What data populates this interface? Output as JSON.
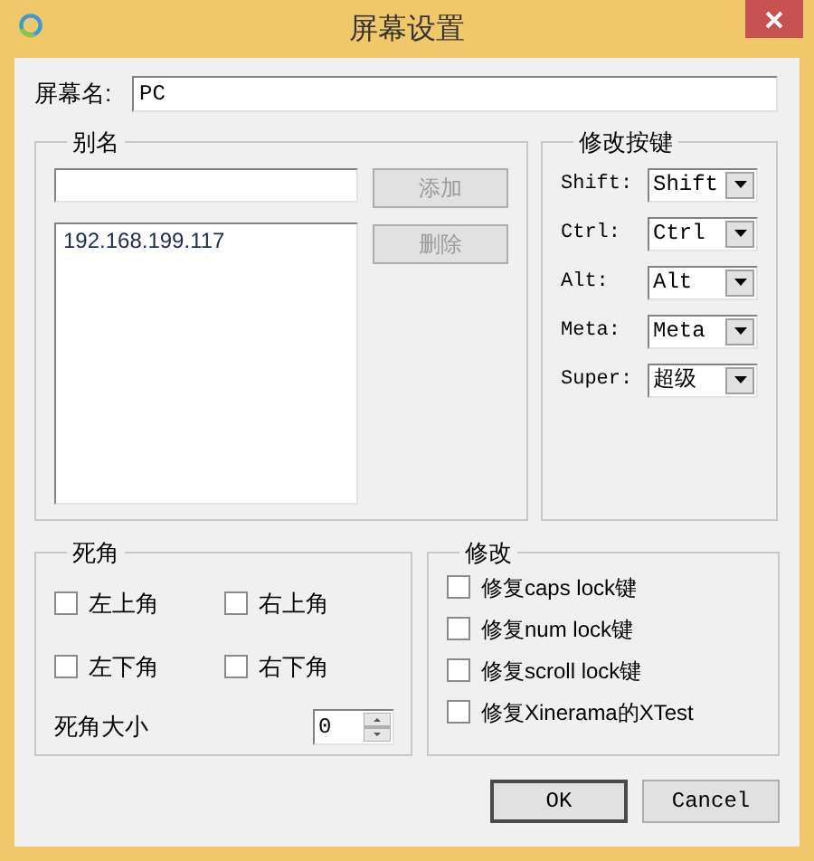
{
  "window": {
    "title": "屏幕设置"
  },
  "screen_name": {
    "label": "屏幕名:",
    "value": "PC"
  },
  "aliases": {
    "title": "别名",
    "add_button": {
      "label": "添加",
      "disabled": true
    },
    "delete_button": {
      "label": "删除",
      "disabled": true
    },
    "items": [
      {
        "text": "192.168.199.117"
      }
    ]
  },
  "modifier_keys": {
    "title": "修改按键",
    "rows": [
      {
        "label": "Shift:",
        "value": "Shift"
      },
      {
        "label": "Ctrl:",
        "value": "Ctrl"
      },
      {
        "label": "Alt:",
        "value": "Alt"
      },
      {
        "label": "Meta:",
        "value": "Meta"
      },
      {
        "label": "Super:",
        "value": "超级"
      }
    ]
  },
  "dead_corners": {
    "title": "死角",
    "corners": [
      {
        "label": "左上角",
        "checked": false
      },
      {
        "label": "右上角",
        "checked": false
      },
      {
        "label": "左下角",
        "checked": false
      },
      {
        "label": "右下角",
        "checked": false
      }
    ],
    "size": {
      "label": "死角大小",
      "value": "0"
    }
  },
  "fixes": {
    "title": "修改",
    "options": [
      {
        "label": "修复caps lock键",
        "checked": false
      },
      {
        "label": "修复num lock键",
        "checked": false
      },
      {
        "label": "修复scroll lock键",
        "checked": false
      },
      {
        "label": "修复Xinerama的XTest",
        "checked": false
      }
    ]
  },
  "buttons": [
    {
      "label": "OK",
      "default": true
    },
    {
      "label": "Cancel",
      "default": false
    }
  ]
}
